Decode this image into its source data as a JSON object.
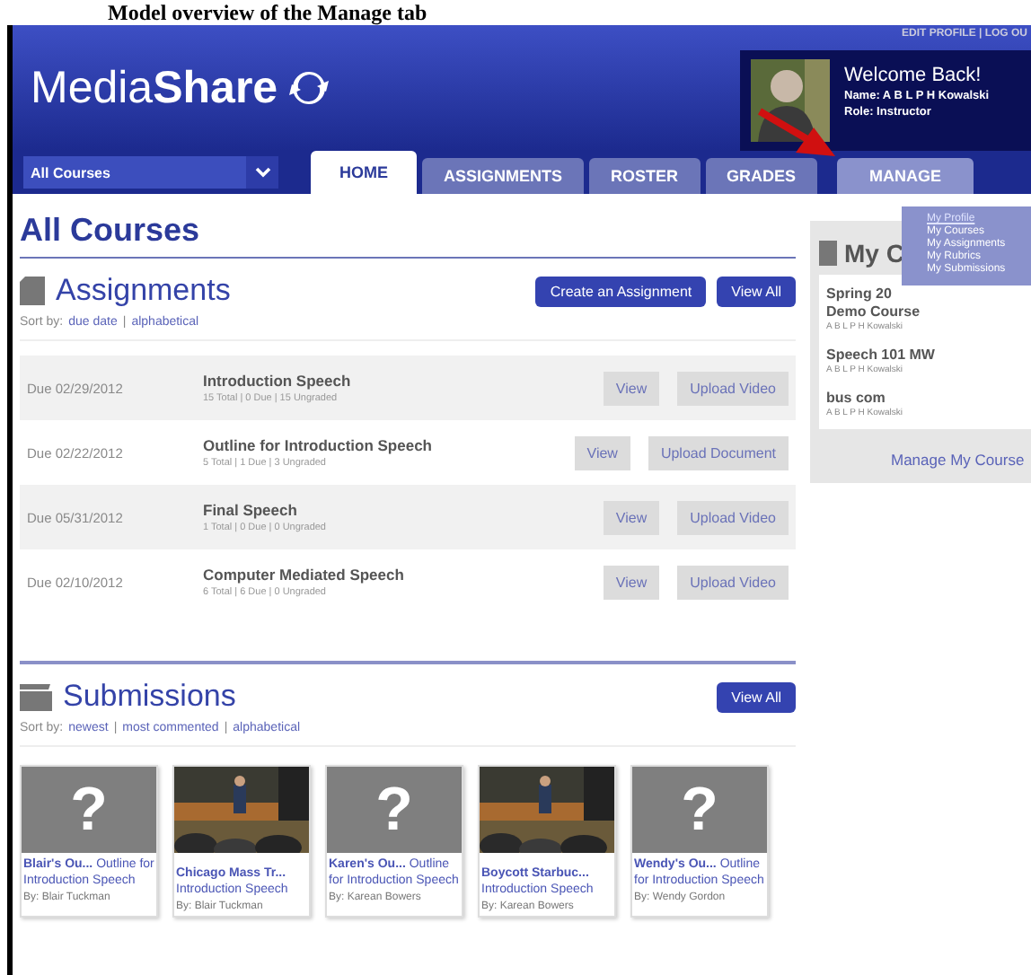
{
  "caption": "Model overview of the Manage tab",
  "header": {
    "logo": {
      "light": "Media",
      "bold": "Share"
    },
    "top_links": "EDIT PROFILE | LOG OU",
    "welcome": "Welcome Back!",
    "name": "Name: A B L P H Kowalski",
    "role": "Role: Instructor"
  },
  "course_select": {
    "value": "All Courses"
  },
  "tabs": [
    {
      "label": "HOME",
      "selected": true,
      "expanded": false
    },
    {
      "label": "ASSIGNMENTS",
      "selected": false,
      "expanded": false
    },
    {
      "label": "ROSTER",
      "selected": false,
      "expanded": false
    },
    {
      "label": "GRADES",
      "selected": false,
      "expanded": false
    },
    {
      "label": "MANAGE",
      "selected": false,
      "expanded": true
    }
  ],
  "manage_menu": [
    {
      "label": "My Profile",
      "selected": true
    },
    {
      "label": "My Courses",
      "selected": false
    },
    {
      "label": "My Assignments",
      "selected": false
    },
    {
      "label": "My Rubrics",
      "selected": false
    },
    {
      "label": "My Submissions",
      "selected": false
    }
  ],
  "page_title": "All Courses",
  "assignments": {
    "title": "Assignments",
    "buttons": [
      "Create an Assignment",
      "View All"
    ],
    "sort_label": "Sort by:",
    "sort_links": [
      "due date",
      "alphabetical"
    ],
    "separator": "|",
    "rows": [
      {
        "due": "Due 02/29/2012",
        "title": "Introduction Speech",
        "counts": "15 Total | 0 Due | 15 Ungraded",
        "actions": [
          "View",
          "Upload Video"
        ]
      },
      {
        "due": "Due 02/22/2012",
        "title": "Outline for Introduction Speech",
        "counts": "5 Total | 1 Due | 3 Ungraded",
        "actions": [
          "View",
          "Upload Document"
        ]
      },
      {
        "due": "Due 05/31/2012",
        "title": "Final Speech",
        "counts": "1 Total | 0 Due | 0 Ungraded",
        "actions": [
          "View",
          "Upload Video"
        ]
      },
      {
        "due": "Due 02/10/2012",
        "title": "Computer Mediated Speech",
        "counts": "6 Total | 6 Due | 0 Ungraded",
        "actions": [
          "View",
          "Upload Video"
        ]
      }
    ]
  },
  "submissions": {
    "title": "Submissions",
    "button": "View All",
    "sort_label": "Sort by:",
    "sort_links": [
      "newest",
      "most commented",
      "alphabetical"
    ],
    "separator": "|",
    "items": [
      {
        "kind": "placeholder",
        "mark": "?",
        "title": "Blair's Ou...",
        "assignment": "Outline for Introduction Speech",
        "author": "By: Blair Tuckman"
      },
      {
        "kind": "picture",
        "title": "Chicago Mass Tr...",
        "assignment": "Introduction Speech",
        "author": "By: Blair Tuckman"
      },
      {
        "kind": "placeholder",
        "mark": "?",
        "title": "Karen's Ou...",
        "assignment": "Outline for Introduction Speech",
        "author": "By: Karean Bowers"
      },
      {
        "kind": "picture",
        "title": "Boycott Starbuc...",
        "assignment": "Introduction Speech",
        "author": "By: Karean Bowers"
      },
      {
        "kind": "placeholder",
        "mark": "?",
        "title": "Wendy's Ou...",
        "assignment": "Outline for Introduction Speech",
        "author": "By: Wendy Gordon"
      }
    ]
  },
  "my_courses": {
    "title": "My C",
    "courses": [
      {
        "lines": [
          "Spring 20",
          "Demo Course"
        ],
        "owner": "A B L P H Kowalski"
      },
      {
        "lines": [
          "Speech 101 MW"
        ],
        "owner": "A B L P H Kowalski"
      },
      {
        "lines": [
          "bus com"
        ],
        "owner": "A B L P H Kowalski"
      }
    ],
    "link": "Manage My Course"
  }
}
